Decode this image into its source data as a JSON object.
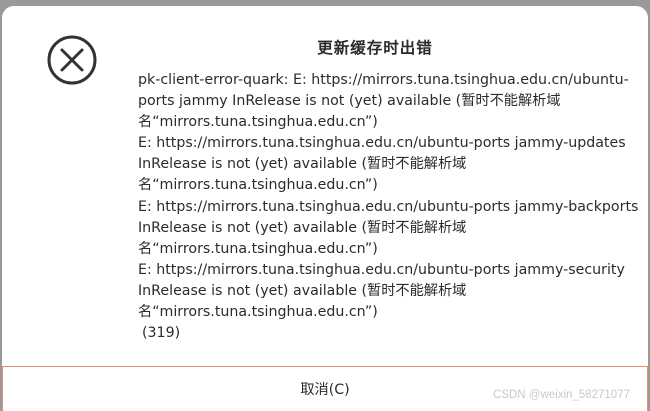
{
  "dialog": {
    "title": "更新缓存时出错",
    "icon": "error-circle-x-icon",
    "message_lines": [
      "pk-client-error-quark: E: https://mirrors.tuna.tsinghua.edu.cn/ubuntu-",
      "ports jammy InRelease is not (yet) available (暂时不能解析域",
      "名“mirrors.tuna.tsinghua.edu.cn”)",
      "E: https://mirrors.tuna.tsinghua.edu.cn/ubuntu-ports jammy-updates",
      "InRelease is not (yet) available (暂时不能解析域",
      "名“mirrors.tuna.tsinghua.edu.cn”)",
      "E: https://mirrors.tuna.tsinghua.edu.cn/ubuntu-ports jammy-backports",
      "InRelease is not (yet) available (暂时不能解析域",
      "名“mirrors.tuna.tsinghua.edu.cn”)",
      "E: https://mirrors.tuna.tsinghua.edu.cn/ubuntu-ports jammy-security",
      "InRelease is not (yet) available (暂时不能解析域",
      "名“mirrors.tuna.tsinghua.edu.cn”)"
    ],
    "error_code": "(319)",
    "cancel_label": "取消(C)"
  },
  "watermark": "CSDN @weixin_58271077",
  "colors": {
    "text": "#2b2b2b",
    "icon": "#333333",
    "button_focus_border": "#e3916b",
    "backdrop": "#9a9a9a"
  }
}
